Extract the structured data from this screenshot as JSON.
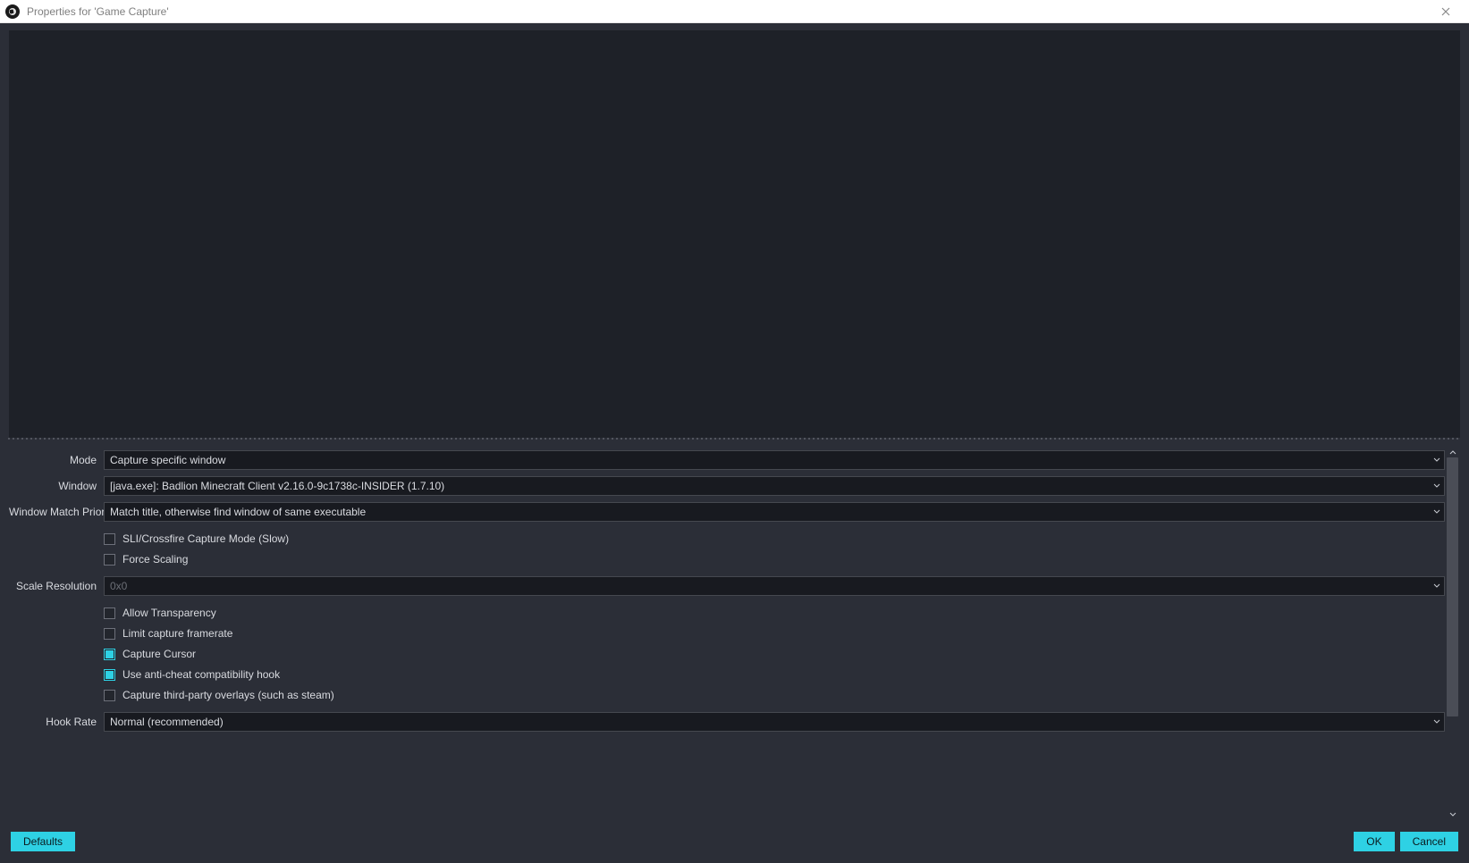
{
  "titlebar": {
    "title": "Properties for 'Game Capture'"
  },
  "form": {
    "mode": {
      "label": "Mode",
      "value": "Capture specific window"
    },
    "window": {
      "label": "Window",
      "value": "[java.exe]: Badlion Minecraft Client v2.16.0-9c1738c-INSIDER (1.7.10)"
    },
    "window_match_priority": {
      "label": "Window Match Priority",
      "value": "Match title, otherwise find window of same executable"
    },
    "sli_crossfire": {
      "label": "SLI/Crossfire Capture Mode (Slow)",
      "checked": false
    },
    "force_scaling": {
      "label": "Force Scaling",
      "checked": false
    },
    "scale_resolution": {
      "label": "Scale Resolution",
      "value": "0x0",
      "disabled": true
    },
    "allow_transparency": {
      "label": "Allow Transparency",
      "checked": false
    },
    "limit_capture_framerate": {
      "label": "Limit capture framerate",
      "checked": false
    },
    "capture_cursor": {
      "label": "Capture Cursor",
      "checked": true
    },
    "anti_cheat_hook": {
      "label": "Use anti-cheat compatibility hook",
      "checked": true
    },
    "third_party_overlays": {
      "label": "Capture third-party overlays (such as steam)",
      "checked": false
    },
    "hook_rate": {
      "label": "Hook Rate",
      "value": "Normal (recommended)"
    }
  },
  "buttons": {
    "defaults": "Defaults",
    "ok": "OK",
    "cancel": "Cancel"
  }
}
